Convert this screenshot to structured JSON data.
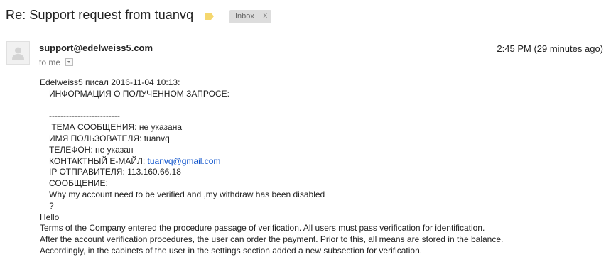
{
  "subject": "Re: Support request from tuanvq",
  "label": {
    "name": "Inbox",
    "close": "x"
  },
  "sender": "support@edelweiss5.com",
  "timestamp": "2:45 PM (29 minutes ago)",
  "recipient": "to me",
  "body": {
    "quote_intro": "Edelweiss5 писал 2016-11-04 10:13:",
    "quote_lines": {
      "info_header": "ИНФОРМАЦИЯ О ПОЛУЧЕННОМ ЗАПРОСЕ:",
      "separator": "-------------------------",
      "topic": " ТЕМА СООБЩЕНИЯ: не указана",
      "username": "ИМЯ ПОЛЬЗОВАТЕЛЯ: tuanvq",
      "phone": "ТЕЛЕФОН: не указан",
      "email_label": "КОНТАКТНЫЙ Е-МАЙЛ: ",
      "email_link": "tuanvq@gmail.com",
      "ip": "IP ОТПРАВИТЕЛЯ: 113.160.66.18",
      "message_label": "СООБЩЕНИЕ:",
      "message": "Why my account need to be verified and ,my withdraw has been disabled",
      "question": "?"
    },
    "reply_lines": [
      "Hello",
      "Terms of the Company entered the procedure passage of verification. All users must pass verification for identification.",
      "After the account verification procedures, the user can order the payment. Prior to this, all means are stored in the balance.",
      "Accordingly, in the cabinets of the user in the settings section added a new subsection for verification."
    ]
  },
  "icons": {
    "importance": "importance-marker-icon",
    "avatar": "default-avatar-icon",
    "details": "chevron-down-icon"
  },
  "colors": {
    "importance_marker": "#f5d76e",
    "link": "#1155cc",
    "label_chip": "#dddddd"
  }
}
